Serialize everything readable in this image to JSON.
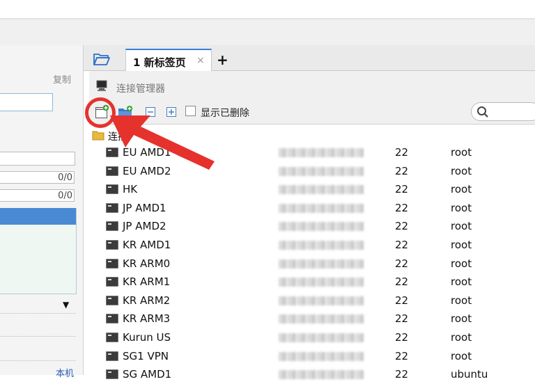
{
  "left_panel": {
    "copy_label": "复制",
    "ratio1": "0/0",
    "ratio2": "0/0",
    "local_link": "本机"
  },
  "tab": {
    "label": "1 新标签页",
    "close": "×",
    "add": "+"
  },
  "dialog": {
    "title": "连接管理器",
    "show_deleted": "显示已删除",
    "root_label": "连接"
  },
  "connections": [
    {
      "name": "EU AMD1",
      "port": "22",
      "user": "root"
    },
    {
      "name": "EU AMD2",
      "port": "22",
      "user": "root"
    },
    {
      "name": "HK",
      "port": "22",
      "user": "root"
    },
    {
      "name": "JP AMD1",
      "port": "22",
      "user": "root"
    },
    {
      "name": "JP AMD2",
      "port": "22",
      "user": "root"
    },
    {
      "name": "KR AMD1",
      "port": "22",
      "user": "root"
    },
    {
      "name": "KR ARM0",
      "port": "22",
      "user": "root"
    },
    {
      "name": "KR ARM1",
      "port": "22",
      "user": "root"
    },
    {
      "name": "KR ARM2",
      "port": "22",
      "user": "root"
    },
    {
      "name": "KR ARM3",
      "port": "22",
      "user": "root"
    },
    {
      "name": "Kurun US",
      "port": "22",
      "user": "root"
    },
    {
      "name": "SG1 VPN",
      "port": "22",
      "user": "root"
    },
    {
      "name": "SG AMD1",
      "port": "22",
      "user": "ubuntu"
    }
  ],
  "colors": {
    "accent": "#3c7fd4",
    "annotation_red": "#e5322d",
    "selection": "#4a8ad4"
  }
}
